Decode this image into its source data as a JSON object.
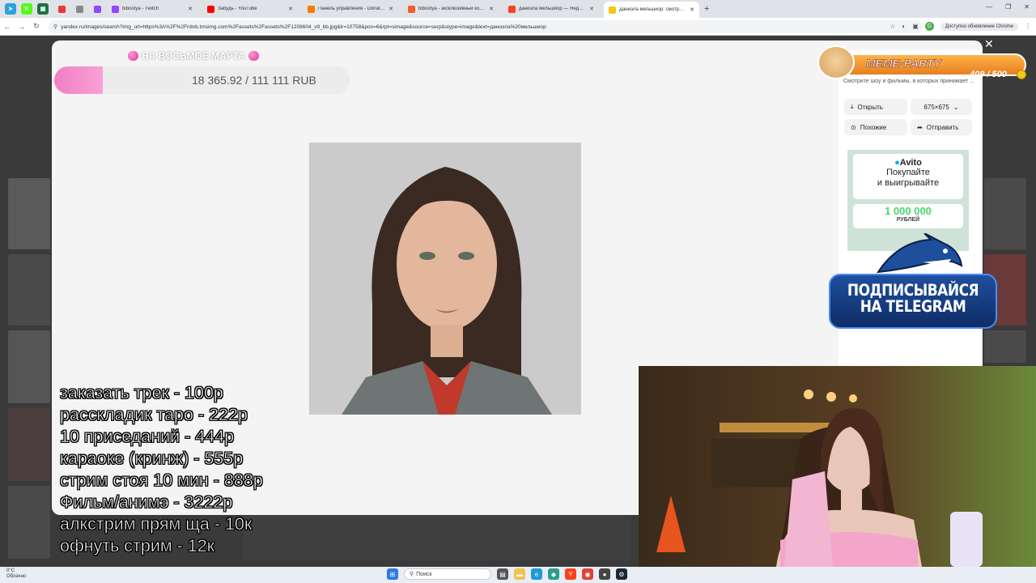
{
  "browser": {
    "pinned_tabs": [
      {
        "icon": "telegram-icon",
        "color": "#2aa3df",
        "glyph": "➤"
      },
      {
        "icon": "kick-icon",
        "color": "#53fc18",
        "glyph": "K"
      },
      {
        "icon": "spreadsheet-icon",
        "color": "#1a7343",
        "glyph": "▦"
      }
    ],
    "tabs": [
      {
        "icon": "bpc-icon",
        "color": "#e53935",
        "label": "",
        "width": 16
      },
      {
        "icon": "speaker-icon",
        "color": "#888888",
        "label": "",
        "width": 16
      },
      {
        "icon": "twitch-icon",
        "color": "#9146ff",
        "label": "",
        "width": 16
      },
      {
        "icon": "twitch-icon",
        "color": "#9146ff",
        "label": "bibooIya - Twitch",
        "width": 112
      },
      {
        "icon": "youtube-icon",
        "color": "#ff0000",
        "label": "Забудь - YouTube",
        "width": 118
      },
      {
        "icon": "donationalerts-icon",
        "color": "#f57c00",
        "label": "Панель управления - DonationAl...",
        "width": 118
      },
      {
        "icon": "boosty-icon",
        "color": "#f15f2c",
        "label": "bibooIya - эксклюзивный конте...",
        "width": 118
      },
      {
        "icon": "yandex-icon",
        "color": "#fc3f1d",
        "label": "даниэла мельшиор — Яндекс...",
        "width": 118
      },
      {
        "icon": "yandex-images-icon",
        "color": "#f5c518",
        "label": "Даниэла мельшиор: смотрите ...",
        "width": 118,
        "active": true
      }
    ],
    "url": "yandex.ru/images/search?img_url=https%3A%2F%2Fnitvb.tmsimg.com%2Fassets%2Fassets%2F1208604_v9_bb.jpg&lr=10758&pos=6&rpt=simage&source=serp&stype=image&text=даниэла%20мельшиор",
    "update_label": "Доступно обновление Chrome"
  },
  "viewer": {
    "description": "Смотрите шоу и фильмы, в которых принимает ...",
    "open_label": "Открыть",
    "size_label": "675×675",
    "similar_label": "Похожие",
    "share_label": "Отправить"
  },
  "ad": {
    "brand": "Avito",
    "headline_1": "Покупайте",
    "headline_2": "и выигрывайте",
    "amount": "1 000 000",
    "amount_unit": "РУБЛЕЙ"
  },
  "donation_goal": {
    "title": "НА ВОСЬМОЕ МАРТА",
    "amount_text": "18 365.92 / 111 111 RUB",
    "progress": 0.1653
  },
  "price_list": [
    "заказать трек - 100р",
    "расскладик таро - 222р",
    "10 приседаний - 444р",
    "караоке (кринж) - 555р",
    "стрим стоя 10 мин - 888р",
    "Фильм/анимэ - 3222р",
    "алкстрим прям ща - 10к",
    "офнуть стрим - 12к"
  ],
  "meme_party": {
    "title": "MEME·PARTY",
    "value": "409 / 500"
  },
  "telegram_banner": {
    "line_1": "ПОДПИСЫВАЙСЯ",
    "line_2": "НА TELEGRAM"
  },
  "taskbar": {
    "weather_temp": "0°C",
    "weather_desc": "Облачно",
    "search_placeholder": "Поиск"
  }
}
